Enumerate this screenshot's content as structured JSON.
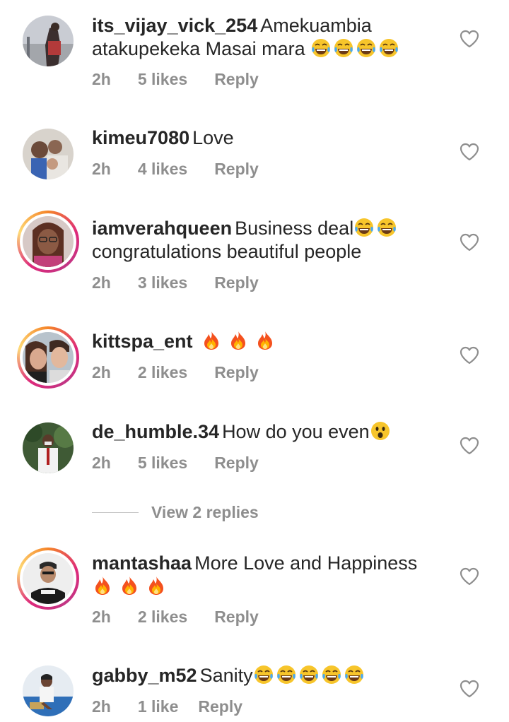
{
  "comments": [
    {
      "username": "its_vijay_vick_254",
      "text": "Amekuambia atakupekeka Masai mara",
      "emojis": [
        "joy",
        "joy",
        "joy",
        "joy"
      ],
      "time": "2h",
      "likes": "5 likes",
      "reply": "Reply",
      "story_ring": false
    },
    {
      "username": "kimeu7080",
      "text": "Love",
      "emojis": [],
      "time": "2h",
      "likes": "4 likes",
      "reply": "Reply",
      "story_ring": false
    },
    {
      "username": "iamverahqueen",
      "text": "Business deal",
      "emojis": [
        "joy",
        "joy"
      ],
      "text2": "congratulations beautiful people",
      "time": "2h",
      "likes": "3 likes",
      "reply": "Reply",
      "story_ring": true
    },
    {
      "username": "kittspa_ent",
      "text": "",
      "emojis": [
        "fire",
        "fire",
        "fire"
      ],
      "time": "2h",
      "likes": "2 likes",
      "reply": "Reply",
      "story_ring": true
    },
    {
      "username": "de_humble.34",
      "text": "How do you even",
      "emojis": [
        "surprised"
      ],
      "time": "2h",
      "likes": "5 likes",
      "reply": "Reply",
      "story_ring": false
    },
    {
      "username": "mantashaa",
      "text": "More Love and Happiness",
      "emojis": [
        "fire",
        "fire",
        "fire"
      ],
      "time": "2h",
      "likes": "2 likes",
      "reply": "Reply",
      "story_ring": true
    },
    {
      "username": "gabby_m52",
      "text": "Sanity",
      "emojis": [
        "joy",
        "joy",
        "joy",
        "joy",
        "joy"
      ],
      "time": "2h",
      "likes": "1 like",
      "reply": "Reply",
      "story_ring": false
    }
  ],
  "view_replies": "View 2 replies",
  "colors": {
    "text": "#262626",
    "meta": "#8e8e8e",
    "heart_outline": "#8e8e8e"
  }
}
